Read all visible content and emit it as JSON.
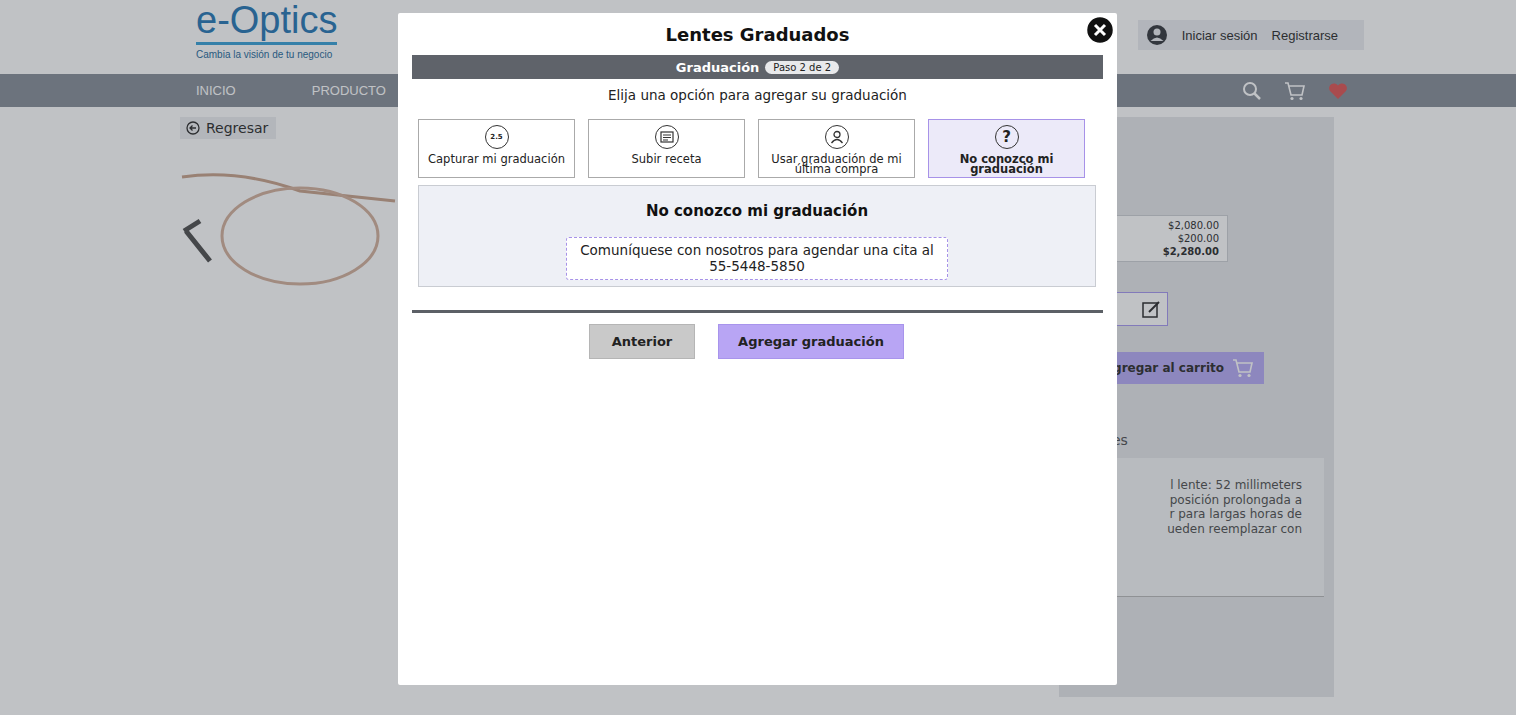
{
  "header": {
    "logo": "e-Optics",
    "tagline": "Cambia la visión de tu negocio",
    "login": "Iniciar sesión",
    "register": "Registrarse"
  },
  "nav": {
    "items": [
      {
        "label": "INICIO"
      },
      {
        "label": "PRODUCTO"
      }
    ]
  },
  "page": {
    "back": "Regresar",
    "prices": [
      "$2,080.00",
      "$200.00",
      "$2,280.00"
    ],
    "cart_button": "Agregar al carrito",
    "tab_fragment": "iciones",
    "description_lines": [
      "l lente: 52 millimeters",
      "posición prolongada a",
      "r para largas horas de",
      "ueden reemplazar con"
    ]
  },
  "modal": {
    "title": "Lentes Graduados",
    "step": {
      "label": "Graduación",
      "badge": "Paso 2 de 2"
    },
    "prompt": "Elija una opción para agregar su graduación",
    "options": [
      {
        "label": "Capturar mi graduación",
        "kind": "capture",
        "icon_text": "2.5",
        "selected": false
      },
      {
        "label": "Subir receta",
        "kind": "upload",
        "selected": false
      },
      {
        "label": "Usar graduación de mi última compra",
        "kind": "history",
        "selected": false
      },
      {
        "label": "No conozco mi graduación",
        "kind": "unknown",
        "icon_text": "?",
        "selected": true
      }
    ],
    "panel": {
      "title": "No conozco mi graduación",
      "message": "Comuníquese con nosotros para agendar una cita al 55-5448-5850"
    },
    "buttons": [
      {
        "label": "Anterior",
        "kind": "secondary"
      },
      {
        "label": "Agregar graduación",
        "kind": "primary"
      }
    ]
  }
}
